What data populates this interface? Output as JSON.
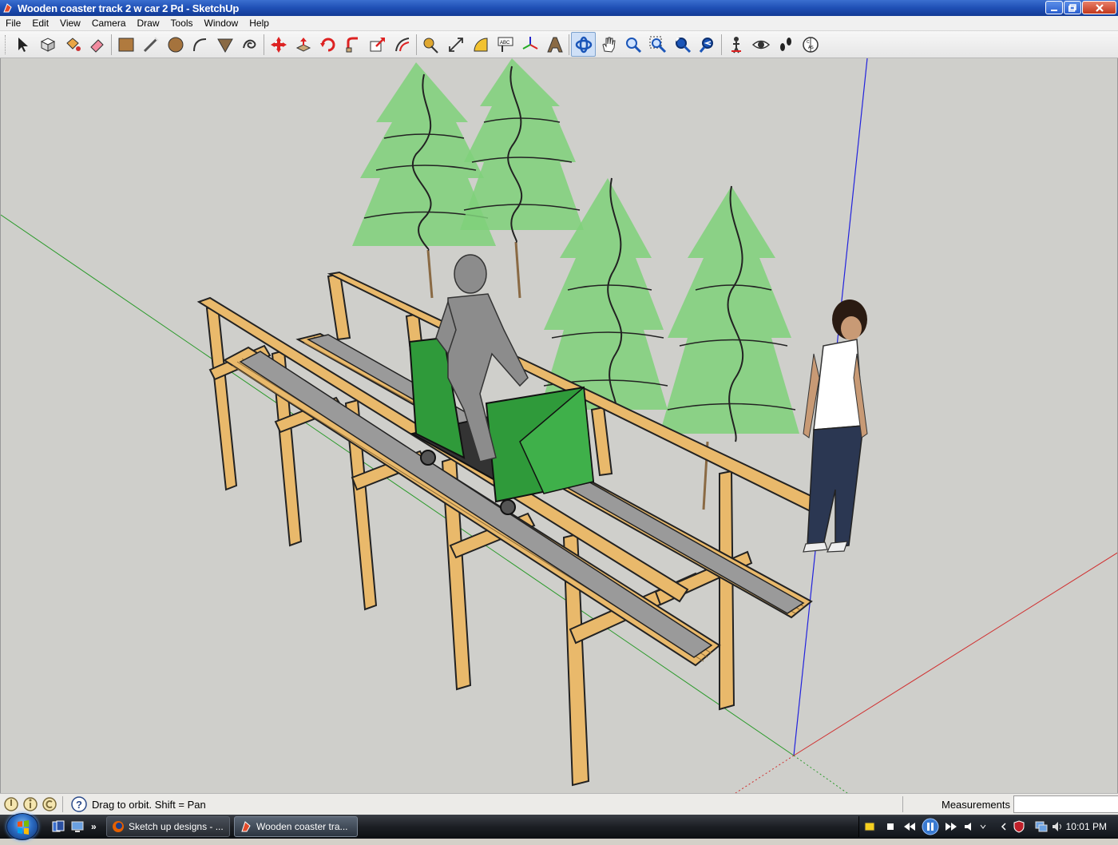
{
  "window": {
    "title": "Wooden coaster track 2 w car 2 Pd - SketchUp"
  },
  "menu": [
    "File",
    "Edit",
    "View",
    "Camera",
    "Draw",
    "Tools",
    "Window",
    "Help"
  ],
  "toolbar": {
    "tools": [
      "select-icon",
      "make-component-icon",
      "paint-bucket-icon",
      "eraser-icon",
      "rectangle-icon",
      "line-icon",
      "circle-icon",
      "arc-icon",
      "polygon-icon",
      "freehand-icon",
      "move-icon",
      "push-pull-icon",
      "rotate-icon",
      "follow-me-icon",
      "scale-icon",
      "offset-icon",
      "tape-measure-icon",
      "dimension-icon",
      "protractor-icon",
      "text-icon",
      "axes-icon",
      "3d-text-icon",
      "orbit-icon",
      "pan-icon",
      "zoom-icon",
      "zoom-window-icon",
      "zoom-extents-icon",
      "previous-view-icon",
      "position-camera-icon",
      "look-around-icon",
      "walk-icon",
      "section-plane-icon"
    ],
    "active_tool": "orbit-icon"
  },
  "status": {
    "hint": "Drag to orbit.  Shift = Pan",
    "measurements_label": "Measurements",
    "measurements_value": ""
  },
  "taskbar": {
    "tasks": [
      {
        "label": "Sketch up designs - ..."
      },
      {
        "label": "Wooden coaster tra..."
      }
    ],
    "clock": "10:01 PM"
  },
  "colors": {
    "viewport_bg": "#cfcfcb",
    "wood": "#e9b96b",
    "car_green": "#2f9a3a",
    "rail": "#8a8a8a",
    "tree_green": "#7fd17a",
    "axis_red": "#d03030",
    "axis_green": "#2a9a2a",
    "axis_blue": "#2222dd"
  }
}
